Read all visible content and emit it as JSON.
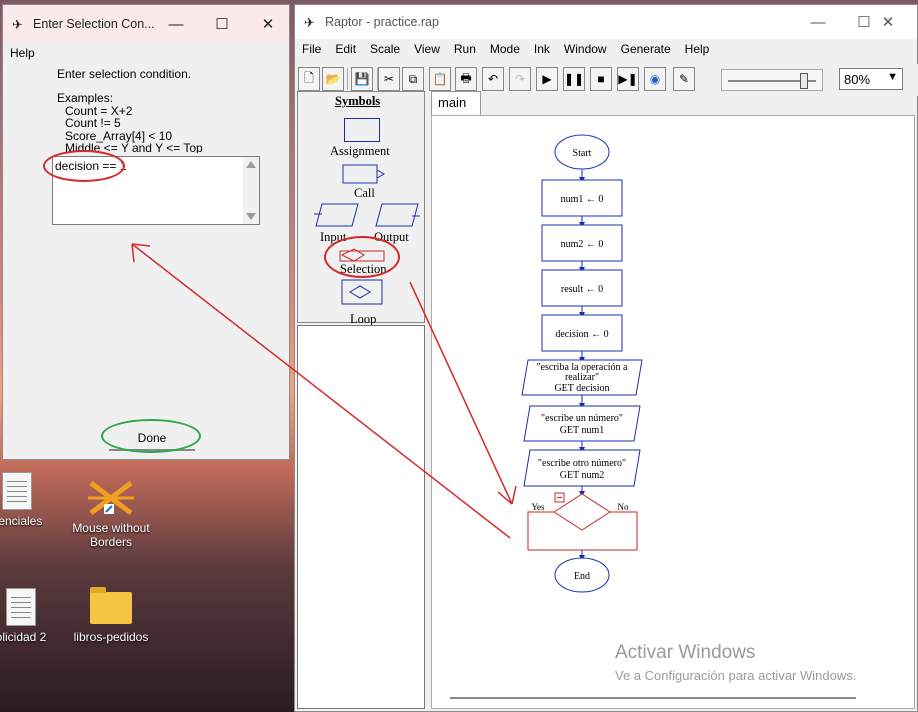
{
  "desktop": {
    "icons": [
      {
        "label": "denciales"
      },
      {
        "label": "Mouse without Borders"
      },
      {
        "label": "olicidad 2"
      },
      {
        "label": "libros-pedidos"
      }
    ],
    "watermark": {
      "title": "Activar Windows",
      "subtitle": "Ve a Configuración para activar Windows."
    }
  },
  "dialog": {
    "title": "Enter Selection Con...",
    "menu_help": "Help",
    "instruction": "Enter selection condition.",
    "examples_heading": "Examples:",
    "examples": [
      "Count = X+2",
      "Count != 5",
      "Score_Array[4] < 10",
      "Middle <= Y and Y <= Top"
    ],
    "input_value": "decision == 1",
    "done_label": "Done"
  },
  "raptor": {
    "title": "Raptor - practice.rap",
    "menu": [
      "File",
      "Edit",
      "Scale",
      "View",
      "Run",
      "Mode",
      "Ink",
      "Window",
      "Generate",
      "Help"
    ],
    "zoom": "80%",
    "symbols_heading": "Symbols",
    "symbols": {
      "assignment": "Assignment",
      "call": "Call",
      "input": "Input",
      "output": "Output",
      "selection": "Selection",
      "loop": "Loop"
    },
    "tab": "main",
    "flow": {
      "start": "Start",
      "a1": "num1 ← 0",
      "a2": "num2 ← 0",
      "a3": "result ← 0",
      "a4": "decision ← 0",
      "in1_l1": "\"escriba la operación a",
      "in1_l2": "realizar\"",
      "in1_l3": "GET decision",
      "in2_l1": "\"escribe un número\"",
      "in2_l2": "GET num1",
      "in3_l1": "\"escribe otro número\"",
      "in3_l2": "GET num2",
      "yes": "Yes",
      "no": "No",
      "end": "End"
    }
  }
}
